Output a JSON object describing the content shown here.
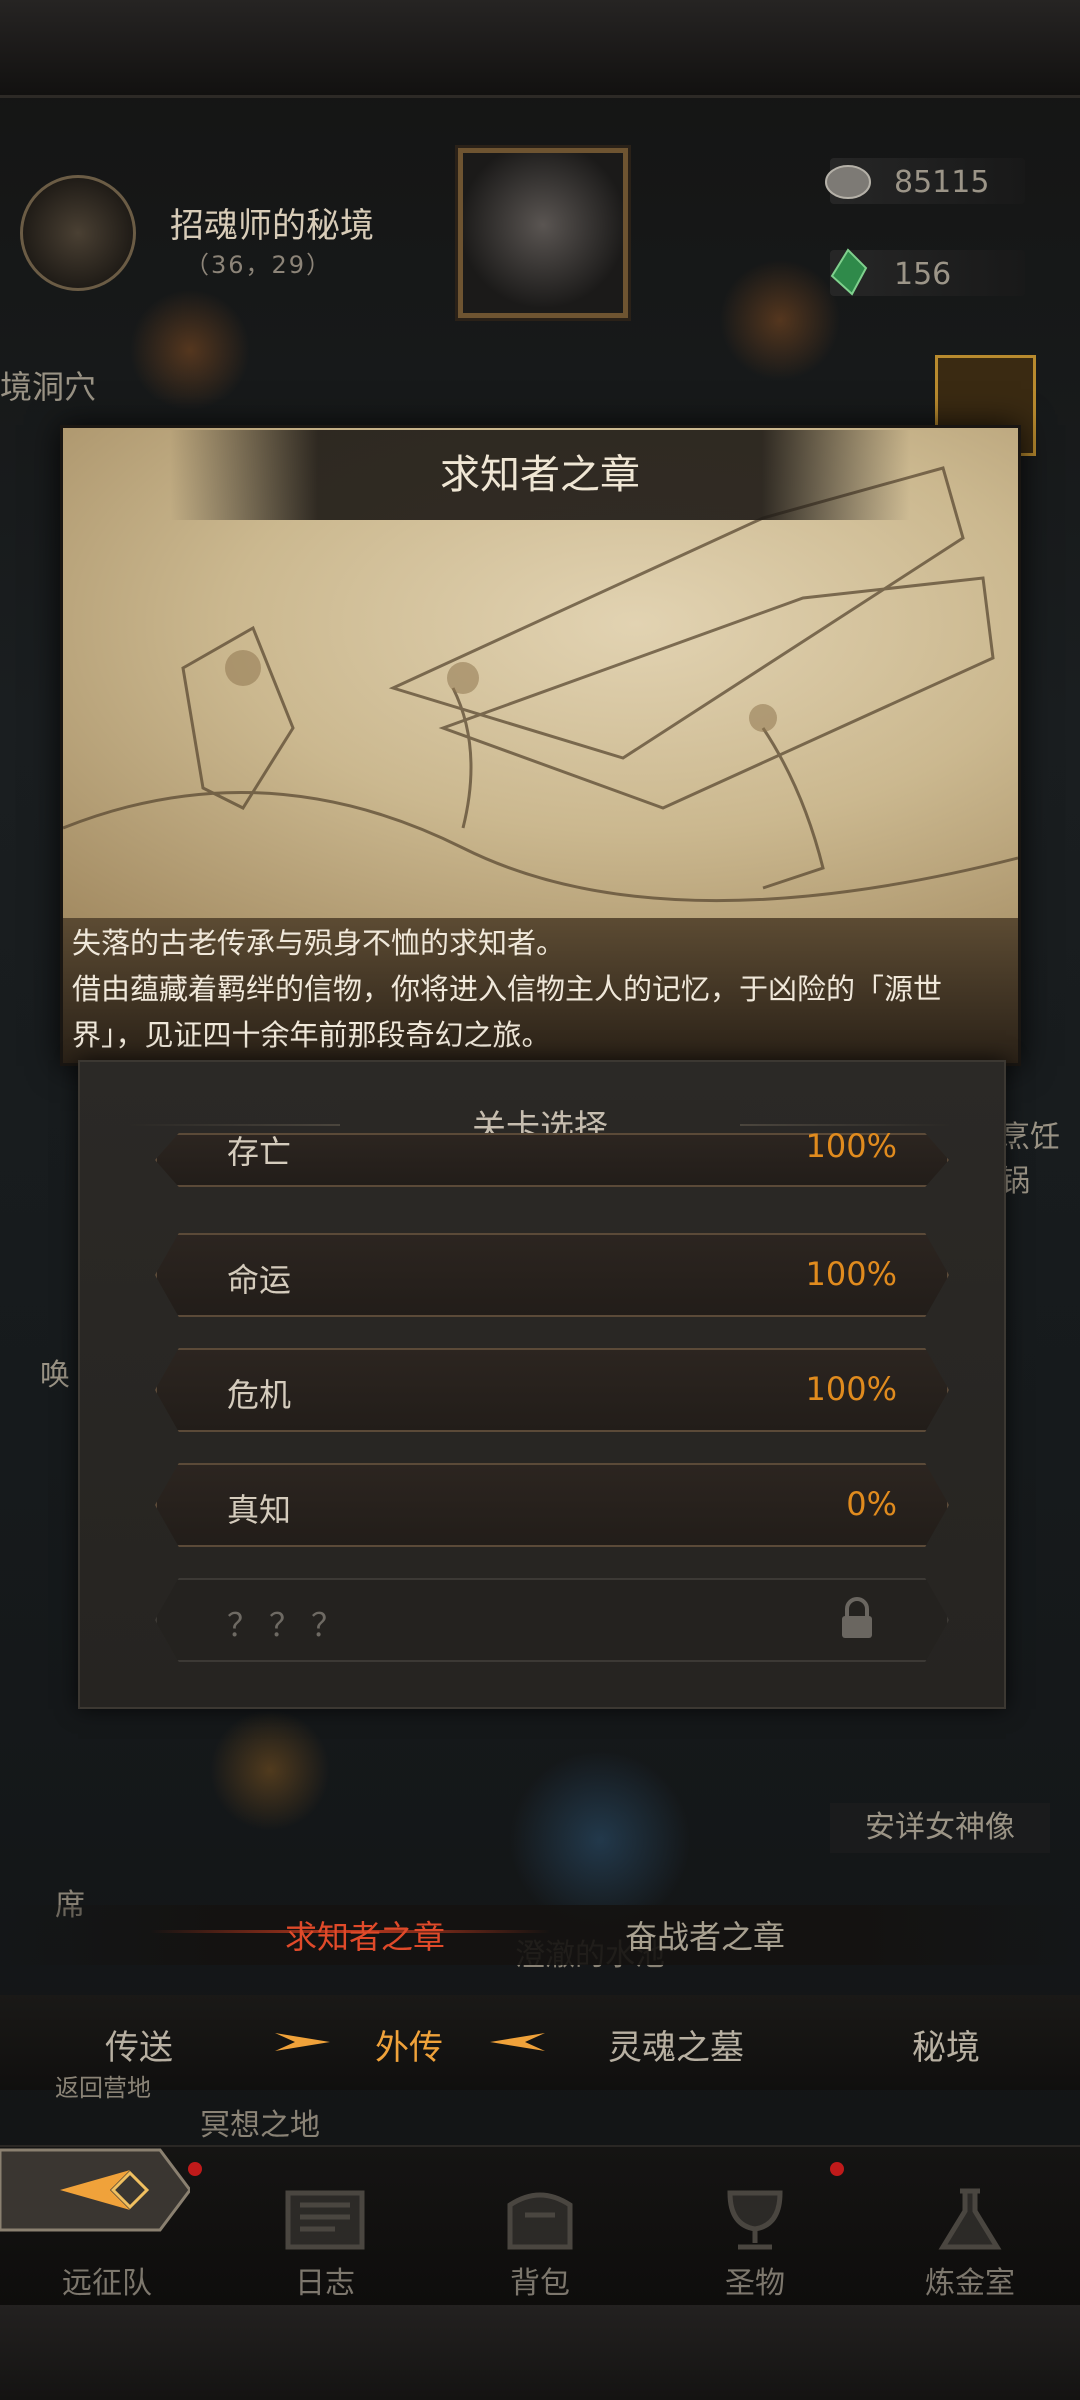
{
  "location": {
    "name": "招魂师的秘境",
    "coords": "（36，29）"
  },
  "resources": [
    {
      "icon": "silver-coin-icon",
      "value": "85115"
    },
    {
      "icon": "green-gem-icon",
      "value": "156"
    }
  ],
  "map_labels": {
    "cave": "境洞穴",
    "cooking": "烹饪锅",
    "huan": "唤",
    "statue": "安详女神像",
    "xi": "席",
    "pond": "澄澈的水池",
    "meditate": "冥想之地",
    "back": "返回营地"
  },
  "chapter_card": {
    "title": "求知者之章",
    "description_line1": "失落的古老传承与殒身不恤的求知者。",
    "description_line2": "借由蕴藏着羁绊的信物，你将进入信物主人的记忆，于凶险的「源世界」，见证四十余年前那段奇幻之旅。"
  },
  "level_select": {
    "title": "关卡选择",
    "stages": [
      {
        "name": "存亡",
        "progress": "100%"
      },
      {
        "name": "命运",
        "progress": "100%"
      },
      {
        "name": "危机",
        "progress": "100%"
      },
      {
        "name": "真知",
        "progress": "0%"
      },
      {
        "name": "？？？",
        "progress": "",
        "locked": true
      }
    ]
  },
  "chapter_tabs": {
    "active": "求知者之章",
    "other": "奋战者之章"
  },
  "mode_tabs": [
    "传送",
    "外传",
    "灵魂之墓",
    "秘境"
  ],
  "active_mode_tab": "外传",
  "nav": [
    "远征队",
    "日志",
    "背包",
    "圣物",
    "炼金室"
  ],
  "colors": {
    "accent_orange": "#e08b1e",
    "chapter_red": "#e04a2a",
    "active_tab": "#f0a23a"
  }
}
